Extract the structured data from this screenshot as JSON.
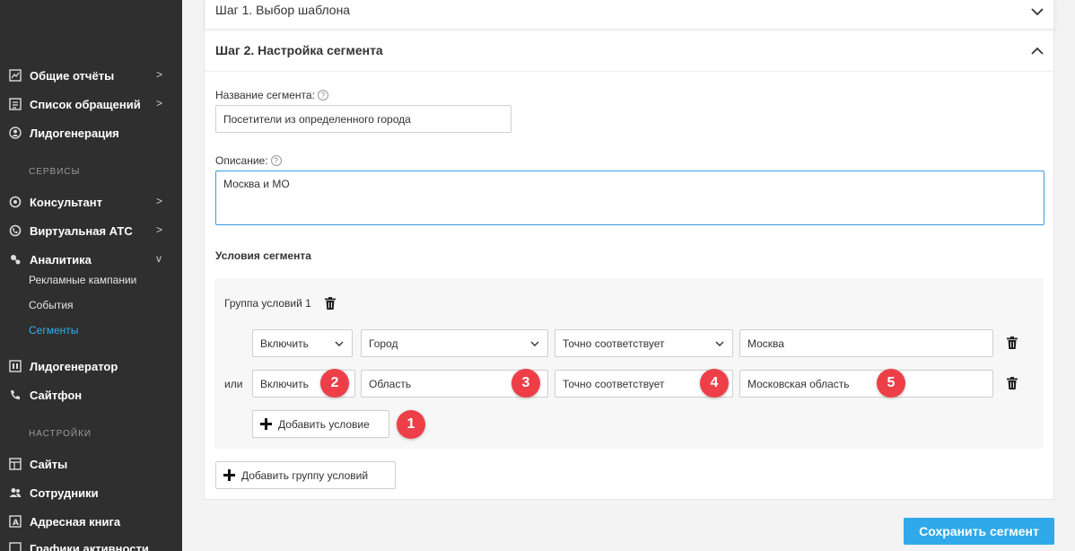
{
  "sidebar": {
    "items": [
      {
        "label": "Общие отчёты",
        "icon": "chart-icon",
        "chevron": ">"
      },
      {
        "label": "Список обращений",
        "icon": "list-icon",
        "chevron": ">"
      },
      {
        "label": "Лидогенерация",
        "icon": "leadgen-icon"
      },
      {
        "label": "Консультант",
        "icon": "chat-icon",
        "chevron": ">"
      },
      {
        "label": "Виртуальная АТС",
        "icon": "phone-icon",
        "chevron": ">"
      },
      {
        "label": "Аналитика",
        "icon": "analytics-icon",
        "chevron": "v"
      },
      {
        "label": "Лидогенератор",
        "icon": "leadgenerator-icon"
      },
      {
        "label": "Сайтфон",
        "icon": "sitephone-icon"
      },
      {
        "label": "Сайты",
        "icon": "sites-icon"
      },
      {
        "label": "Сотрудники",
        "icon": "users-icon"
      },
      {
        "label": "Адресная книга",
        "icon": "addressbook-icon"
      },
      {
        "label": "Графики активности",
        "icon": "activity-icon"
      }
    ],
    "sections": {
      "services": "СЕРВИСЫ",
      "settings": "НАСТРОЙКИ"
    },
    "analytics_sub": [
      {
        "label": "Рекламные кампании"
      },
      {
        "label": "События"
      },
      {
        "label": "Сегменты",
        "active": true
      }
    ]
  },
  "step1": {
    "title": "Шаг 1. Выбор шаблона"
  },
  "step2": {
    "title": "Шаг 2. Настройка сегмента",
    "name_label": "Название сегмента:",
    "name_value": "Посетители из определенного города",
    "description_label": "Описание:",
    "description_value": "Москва и МО",
    "conditions_title": "Условия сегмента",
    "group": {
      "title": "Группа условий 1",
      "or_label": "или",
      "rows": [
        {
          "include": "Включить",
          "field": "Город",
          "operator": "Точно соответствует",
          "value": "Москва"
        },
        {
          "include": "Включить",
          "field": "Область",
          "operator": "Точно соответствует",
          "value": "Московская область"
        }
      ],
      "add_condition": "Добавить условие"
    },
    "add_group": "Добавить группу условий"
  },
  "badges": [
    "1",
    "2",
    "3",
    "4",
    "5"
  ],
  "save_button": "Сохранить сегмент",
  "colors": {
    "accent": "#2fa9ea",
    "badge": "#ee3f49",
    "sidebar": "#2f2f2f",
    "active_link": "#2fb0ef"
  }
}
